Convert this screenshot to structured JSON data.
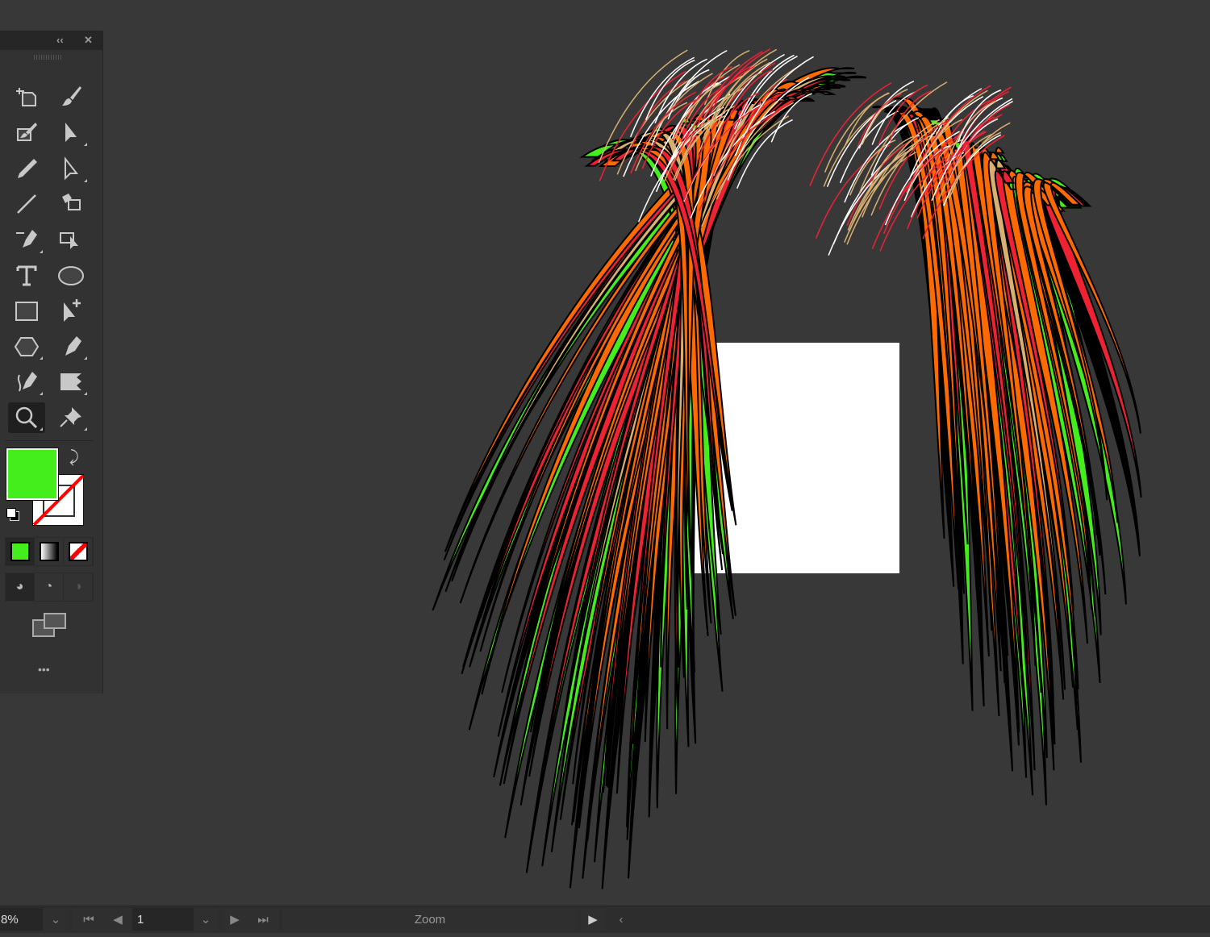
{
  "toolbar": {
    "collapse_icon": "double-chevron-left-icon",
    "close_icon": "close-icon",
    "tools": [
      {
        "name": "artboard-tool",
        "icon": "artboard-icon"
      },
      {
        "name": "paintbrush-tool",
        "icon": "paintbrush-icon"
      },
      {
        "name": "blob-brush-tool",
        "icon": "blob-brush-icon"
      },
      {
        "name": "selection-tool",
        "icon": "selection-arrow-icon"
      },
      {
        "name": "pencil-tool",
        "icon": "pencil-icon"
      },
      {
        "name": "direct-selection-tool",
        "icon": "direct-selection-icon"
      },
      {
        "name": "line-segment-tool",
        "icon": "line-icon"
      },
      {
        "name": "live-paint-bucket-tool",
        "icon": "live-paint-icon"
      },
      {
        "name": "curvature-tool",
        "icon": "curvature-pen-icon"
      },
      {
        "name": "live-paint-selection-tool",
        "icon": "live-paint-select-icon"
      },
      {
        "name": "type-tool",
        "icon": "type-icon"
      },
      {
        "name": "ellipse-tool",
        "icon": "ellipse-icon"
      },
      {
        "name": "rectangle-tool",
        "icon": "rectangle-icon"
      },
      {
        "name": "add-anchor-tool",
        "icon": "add-anchor-arrow-icon"
      },
      {
        "name": "polygon-tool",
        "icon": "polygon-icon"
      },
      {
        "name": "pen-tool",
        "icon": "pen-icon"
      },
      {
        "name": "freeform-pen-tool",
        "icon": "freeform-pen-icon"
      },
      {
        "name": "shape-builder-tool",
        "icon": "shape-builder-icon"
      },
      {
        "name": "zoom-tool",
        "icon": "magnifier-icon",
        "active": true
      },
      {
        "name": "puppet-warp-tool",
        "icon": "pin-icon"
      }
    ],
    "more_label": "•••"
  },
  "colors": {
    "fill": "#44ee1c",
    "stroke": "none",
    "canvas": "#383838",
    "artboard": "#ffffff",
    "wing_palette": [
      "#ff6a00",
      "#ee2233",
      "#d9b070",
      "#44ee1c",
      "#000000",
      "#ffffff"
    ]
  },
  "statusbar": {
    "zoom_value": "8%",
    "artboard_number": "1",
    "status_label": "Zoom"
  }
}
